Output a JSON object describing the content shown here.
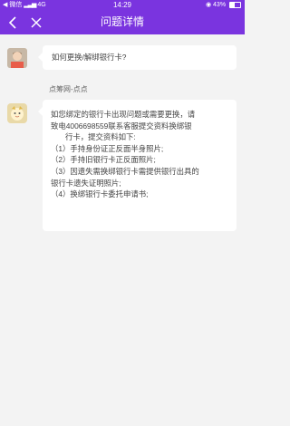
{
  "status_bar": {
    "carrier": "◀ 微信",
    "network": "4G",
    "time": "14:29",
    "battery": "43%"
  },
  "nav": {
    "title": "问题详情"
  },
  "question": {
    "text": "如何更换/解绑银行卡?"
  },
  "answer": {
    "sender": "点筹网-点点",
    "lines": [
      "如您绑定的银行卡出现问题或需要更换，请",
      "致电4006698559联系客服提交资料换绑银",
      "行卡，提交资料如下:",
      "（1）手持身份证正反面半身照片;",
      "（2）手持旧银行卡正反面照片;",
      "（3）因遗失需换绑银行卡需提供银行出具的",
      "银行卡遗失证明照片;",
      "（4）换绑银行卡委托申请书;"
    ]
  },
  "colors": {
    "header": "#7a34df",
    "background": "#f3f3f3"
  }
}
